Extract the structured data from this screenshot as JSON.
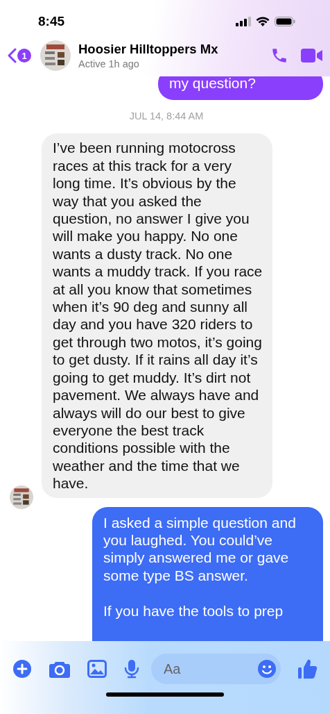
{
  "status_bar": {
    "time": "8:45"
  },
  "header": {
    "unread_count": "1",
    "name": "Hoosier Hilltoppers Mx",
    "status": "Active 1h ago"
  },
  "messages": [
    {
      "kind": "sent",
      "color": "#8a3ffc",
      "text": "my question?"
    },
    {
      "kind": "timestamp",
      "text": "JUL 14, 8:44 AM"
    },
    {
      "kind": "received",
      "text": "I’ve been running motocross races at this track for a very long time. It’s obvious by the way that you asked the question, no answer I give you will make you happy. No one wants a dusty track. No one wants a muddy track. If you race at all you know that sometimes when it’s 90 deg and sunny all day and you have 320 riders to get through two motos, it’s going to get dusty. If it rains all day it’s going to get muddy. It’s dirt not pavement. We always have and always will do our best to give everyone the best track conditions possible with the weather and the time that we have."
    },
    {
      "kind": "sent",
      "color": "#3d6cf5",
      "text": "I asked a simple question and you laughed.  You could’ve simply answered me or gave some type BS answer.\n\nIf you have the tools to prep"
    }
  ],
  "composer": {
    "placeholder": "Aa"
  }
}
